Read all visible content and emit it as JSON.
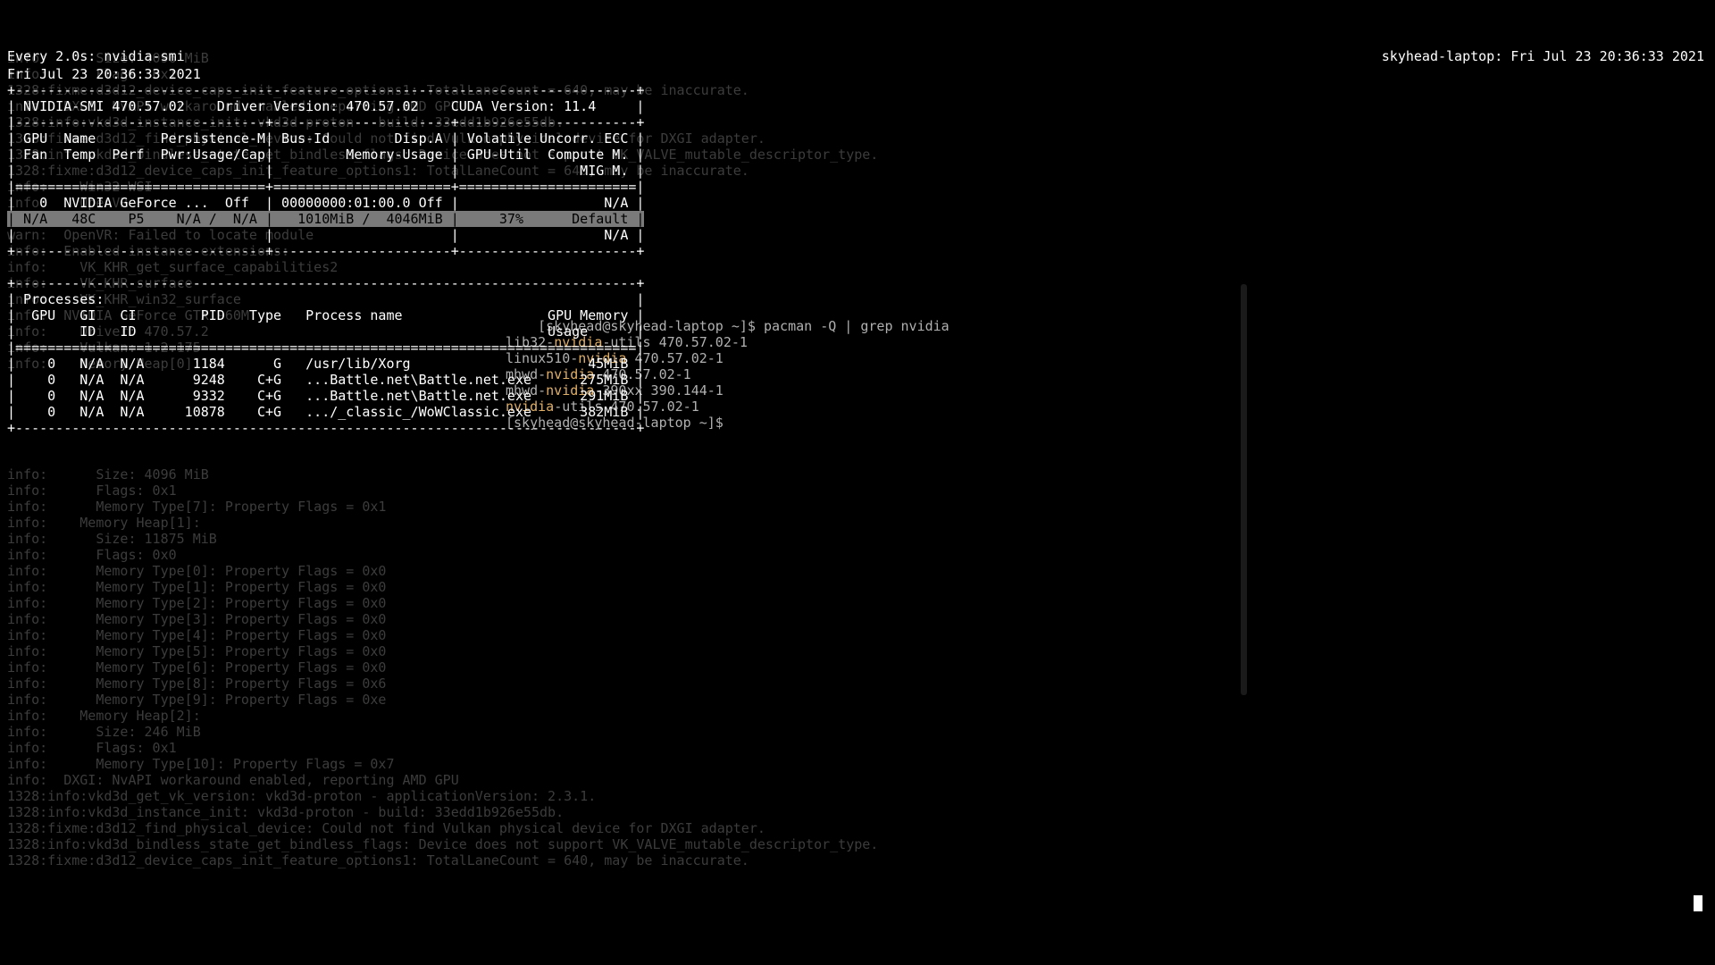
{
  "watch": {
    "left": "Every 2.0s: nvidia-smi",
    "right": "skyhead-laptop: Fri Jul 23 20:36:33 2021",
    "date_line": "Fri Jul 23 20:36:33 2021",
    "sep_top": "+-----------------------------------------------------------------------------+",
    "hdr1": "| NVIDIA-SMI 470.57.02    Driver Version: 470.57.02    CUDA Version: 11.4     |",
    "sep_mid": "|-------------------------------+----------------------+----------------------+",
    "col1": "| GPU  Name        Persistence-M| Bus-Id        Disp.A | Volatile Uncorr. ECC |",
    "col2": "| Fan  Temp  Perf  Pwr:Usage/Cap|         Memory-Usage | GPU-Util  Compute M. |",
    "col3": "|                               |                      |               MIG M. |",
    "sep_eq": "|===============================+======================+======================|",
    "row1": "|   0  NVIDIA GeForce ...  Off  | 00000000:01:00.0 Off |                  N/A |",
    "row2": "| N/A   48C    P5    N/A /  N/A |   1010MiB /  4046MiB |     37%      Default |",
    "row3": "|                               |                      |                  N/A |",
    "sep_bot": "+-------------------------------+----------------------+----------------------+",
    "blank": "                                                                               ",
    "proc_top": "+-----------------------------------------------------------------------------+",
    "proc_hdr": "| Processes:                                                                  |",
    "proc_c1": "|  GPU   GI   CI        PID   Type   Process name                  GPU Memory |",
    "proc_c2": "|        ID   ID                                                   Usage      |",
    "proc_eq": "|=============================================================================|",
    "p0": "|    0   N/A  N/A      1184      G   /usr/lib/Xorg                      45MiB |",
    "p1": "|    0   N/A  N/A      9248    C+G   ...Battle.net\\Battle.net.exe      275MiB |",
    "p2": "|    0   N/A  N/A      9332    C+G   ...Battle.net\\Battle.net.exe      291MiB |",
    "p3": "|    0   N/A  N/A     10878    C+G   .../_classic_/WoWClassic.exe      382MiB |",
    "proc_bot": "+-----------------------------------------------------------------------------+"
  },
  "ghost_pre": "info:      Size: 4096 MiB\ninfo:      Flags: 0x1\n1328:fixme:d3d12_device_caps_init_feature_options1: TotalLaneCount = 640, may be inaccurate.\ninfo:  DXGI: NvAPI workaround enabled, reporting AMD GPU\n1328:info:vkd3d_instance_init: vkd3d-proton - build: 33edd1b926e55db.\n1328:fixme:d3d12_find_physical_device: Could not find Vulkan physical device for DXGI adapter.\n1328:info:vkd3d_bindless_state_get_bindless_flags: Device does not support VK_VALVE_mutable_descriptor_type.\n1328:fixme:d3d12_device_caps_init_feature_options1: TotalLaneCount = 640, may be inaccurate.\ninfo:    Win32 WSI\ninfo:    OpenVR\ninfo:    OpenXR\nwarn:  OpenVR: Failed to locate module\ninfo:  Enabled instance extensions:\ninfo:    VK_KHR_get_surface_capabilities2\ninfo:    VK_KHR_surface\ninfo:    VK_KHR_win32_surface\ninfo:  NVIDIA GeForce GTX 960M:\ninfo:    Driver: 470.57.2\ninfo:    Vulkan: 1.2.175\ninfo:    Memory Heap[0]:",
  "ghost": "info:      Size: 4096 MiB\ninfo:      Flags: 0x1\ninfo:      Memory Type[7]: Property Flags = 0x1\ninfo:    Memory Heap[1]:\ninfo:      Size: 11875 MiB\ninfo:      Flags: 0x0\ninfo:      Memory Type[0]: Property Flags = 0x0\ninfo:      Memory Type[1]: Property Flags = 0x0\ninfo:      Memory Type[2]: Property Flags = 0x0\ninfo:      Memory Type[3]: Property Flags = 0x0\ninfo:      Memory Type[4]: Property Flags = 0x0\ninfo:      Memory Type[5]: Property Flags = 0x0\ninfo:      Memory Type[6]: Property Flags = 0x0\ninfo:      Memory Type[8]: Property Flags = 0x6\ninfo:      Memory Type[9]: Property Flags = 0xe\ninfo:    Memory Heap[2]:\ninfo:      Size: 246 MiB\ninfo:      Flags: 0x1\ninfo:      Memory Type[10]: Property Flags = 0x7\ninfo:  DXGI: NvAPI workaround enabled, reporting AMD GPU\n1328:info:vkd3d_get_vk_version: vkd3d-proton - applicationVersion: 2.3.1.\n1328:info:vkd3d_instance_init: vkd3d-proton - build: 33edd1b926e55db.\n1328:fixme:d3d12_find_physical_device: Could not find Vulkan physical device for DXGI adapter.\n1328:info:vkd3d_bindless_state_get_bindless_flags: Device does not support VK_VALVE_mutable_descriptor_type.\n1328:fixme:d3d12_device_caps_init_feature_options1: TotalLaneCount = 640, may be inaccurate.",
  "pacman": {
    "prompt": "[skyhead@skyhead-laptop ~]$ pacman -Q | grep nvidia",
    "l0": "lib32-nvidia-utils 470.57.02-1",
    "l1": "linux510-nvidia 470.57.02-1",
    "l2": "mhwd-nvidia 470.57.02-1",
    "l3": "mhwd-nvidia-390xx 390.144-1",
    "l4": "nvidia-utils 470.57.02-1",
    "prompt2": "[skyhead@skyhead-laptop ~]$ "
  }
}
